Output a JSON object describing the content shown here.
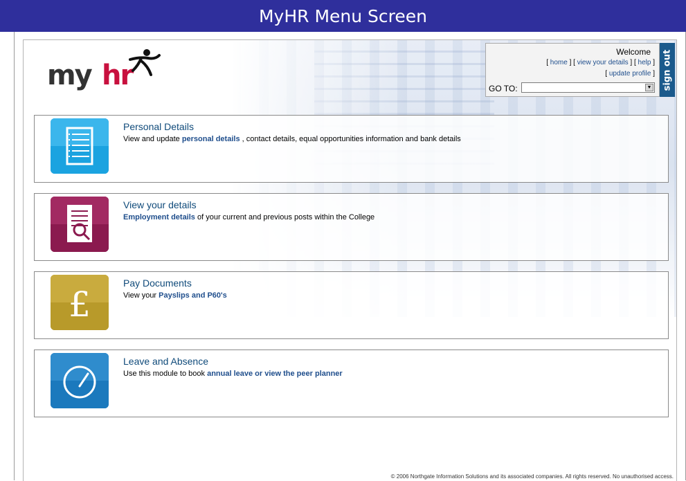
{
  "window": {
    "title": "MyHR Menu Screen"
  },
  "logo": {
    "my": "my",
    "hr": "hr"
  },
  "header": {
    "welcome": "Welcome",
    "home_link": "home",
    "view_details_link": "view your details",
    "help_link": "help",
    "update_profile_link": "update profile",
    "goto_label": "GO TO:",
    "goto_value": "",
    "signout_label": "sign out"
  },
  "cards": [
    {
      "title": "Personal Details",
      "desc_pre": "View and update ",
      "desc_bold": "personal details",
      "desc_post": " , contact details, equal opportunities information and bank details",
      "icon": "document-list-icon",
      "color": "#1ba3e0"
    },
    {
      "title": "View your details",
      "desc_pre": "",
      "desc_bold": "Employment details",
      "desc_post": " of your current and previous posts within the College",
      "icon": "document-search-icon",
      "color": "#8b1a4f"
    },
    {
      "title": "Pay Documents",
      "desc_pre": "View your ",
      "desc_bold": "Payslips and P60's",
      "desc_post": "",
      "icon": "pound-icon",
      "color": "#b89a2a"
    },
    {
      "title": "Leave and Absence",
      "desc_pre": "Use this module to book ",
      "desc_bold": "annual leave or view the peer planner",
      "desc_post": "",
      "icon": "clock-icon",
      "color": "#1b79bd"
    }
  ],
  "footer": "© 2006 Northgate Information Solutions and its associated companies. All rights reserved. No unauthorised access."
}
